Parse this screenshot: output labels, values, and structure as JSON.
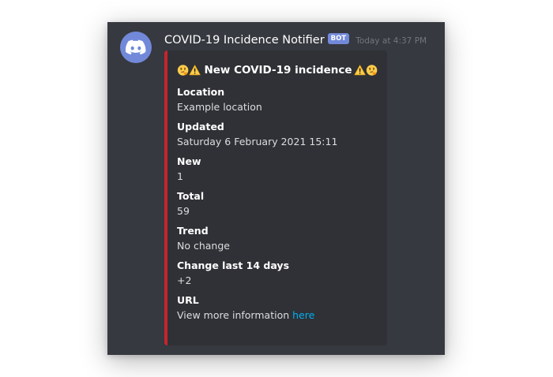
{
  "message": {
    "author": "COVID-19 Incidence Notifier",
    "bot_tag": "BOT",
    "timestamp": "Today at 4:37 PM",
    "avatar_icon": "discord-logo-icon"
  },
  "embed": {
    "accent_color": "#c8242c",
    "title": "New COVID-19 incidence",
    "title_emojis": [
      "thinking-face-icon",
      "warning-icon",
      "warning-icon",
      "thinking-face-icon"
    ],
    "fields": [
      {
        "name": "Location",
        "value": "Example location"
      },
      {
        "name": "Updated",
        "value": "Saturday 6 February 2021 15:11"
      },
      {
        "name": "New",
        "value": "1"
      },
      {
        "name": "Total",
        "value": "59"
      },
      {
        "name": "Trend",
        "value": "No change"
      },
      {
        "name": "Change last 14 days",
        "value": "+2"
      }
    ],
    "url_field": {
      "name": "URL",
      "value_prefix": "View more information ",
      "link_text": "here"
    }
  },
  "colors": {
    "background": "#36393f",
    "embed_background": "#2f3136",
    "bot_tag": "#7289da",
    "link": "#00b0f4"
  }
}
